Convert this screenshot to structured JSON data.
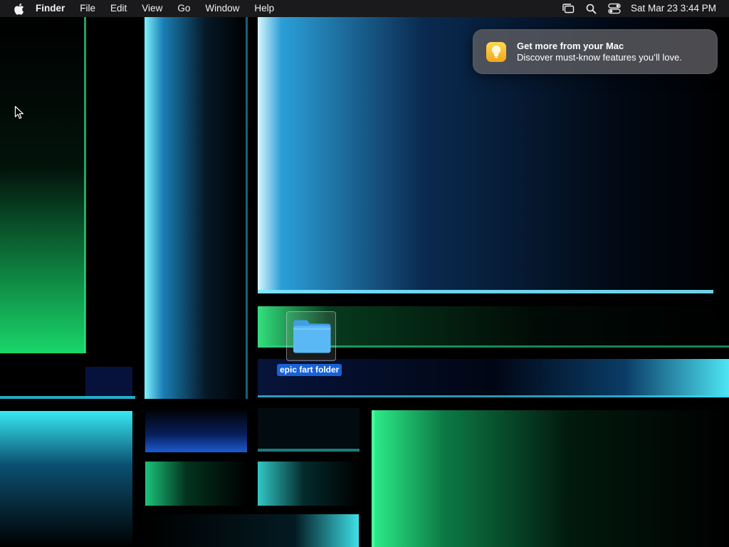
{
  "menubar": {
    "apple_icon": "apple-logo-icon",
    "app_name": "Finder",
    "menus": [
      "File",
      "Edit",
      "View",
      "Go",
      "Window",
      "Help"
    ],
    "status_icons": [
      "stage-manager-icon",
      "search-icon",
      "control-center-icon"
    ],
    "clock": "Sat Mar 23  3:44 PM"
  },
  "notification": {
    "app_icon": "lightbulb-icon",
    "title": "Get more from your Mac",
    "body": "Discover must-know features you’ll love."
  },
  "desktop": {
    "items": [
      {
        "label": "epic fart folder",
        "icon": "folder-icon",
        "selected": true
      }
    ]
  },
  "colors": {
    "menubar_bg": "#1c1c1e",
    "selection_blue": "#1862d8",
    "folder_blue": "#5ab8f5",
    "accent_cyan": "#38d6f0",
    "accent_green": "#2ee07a"
  }
}
